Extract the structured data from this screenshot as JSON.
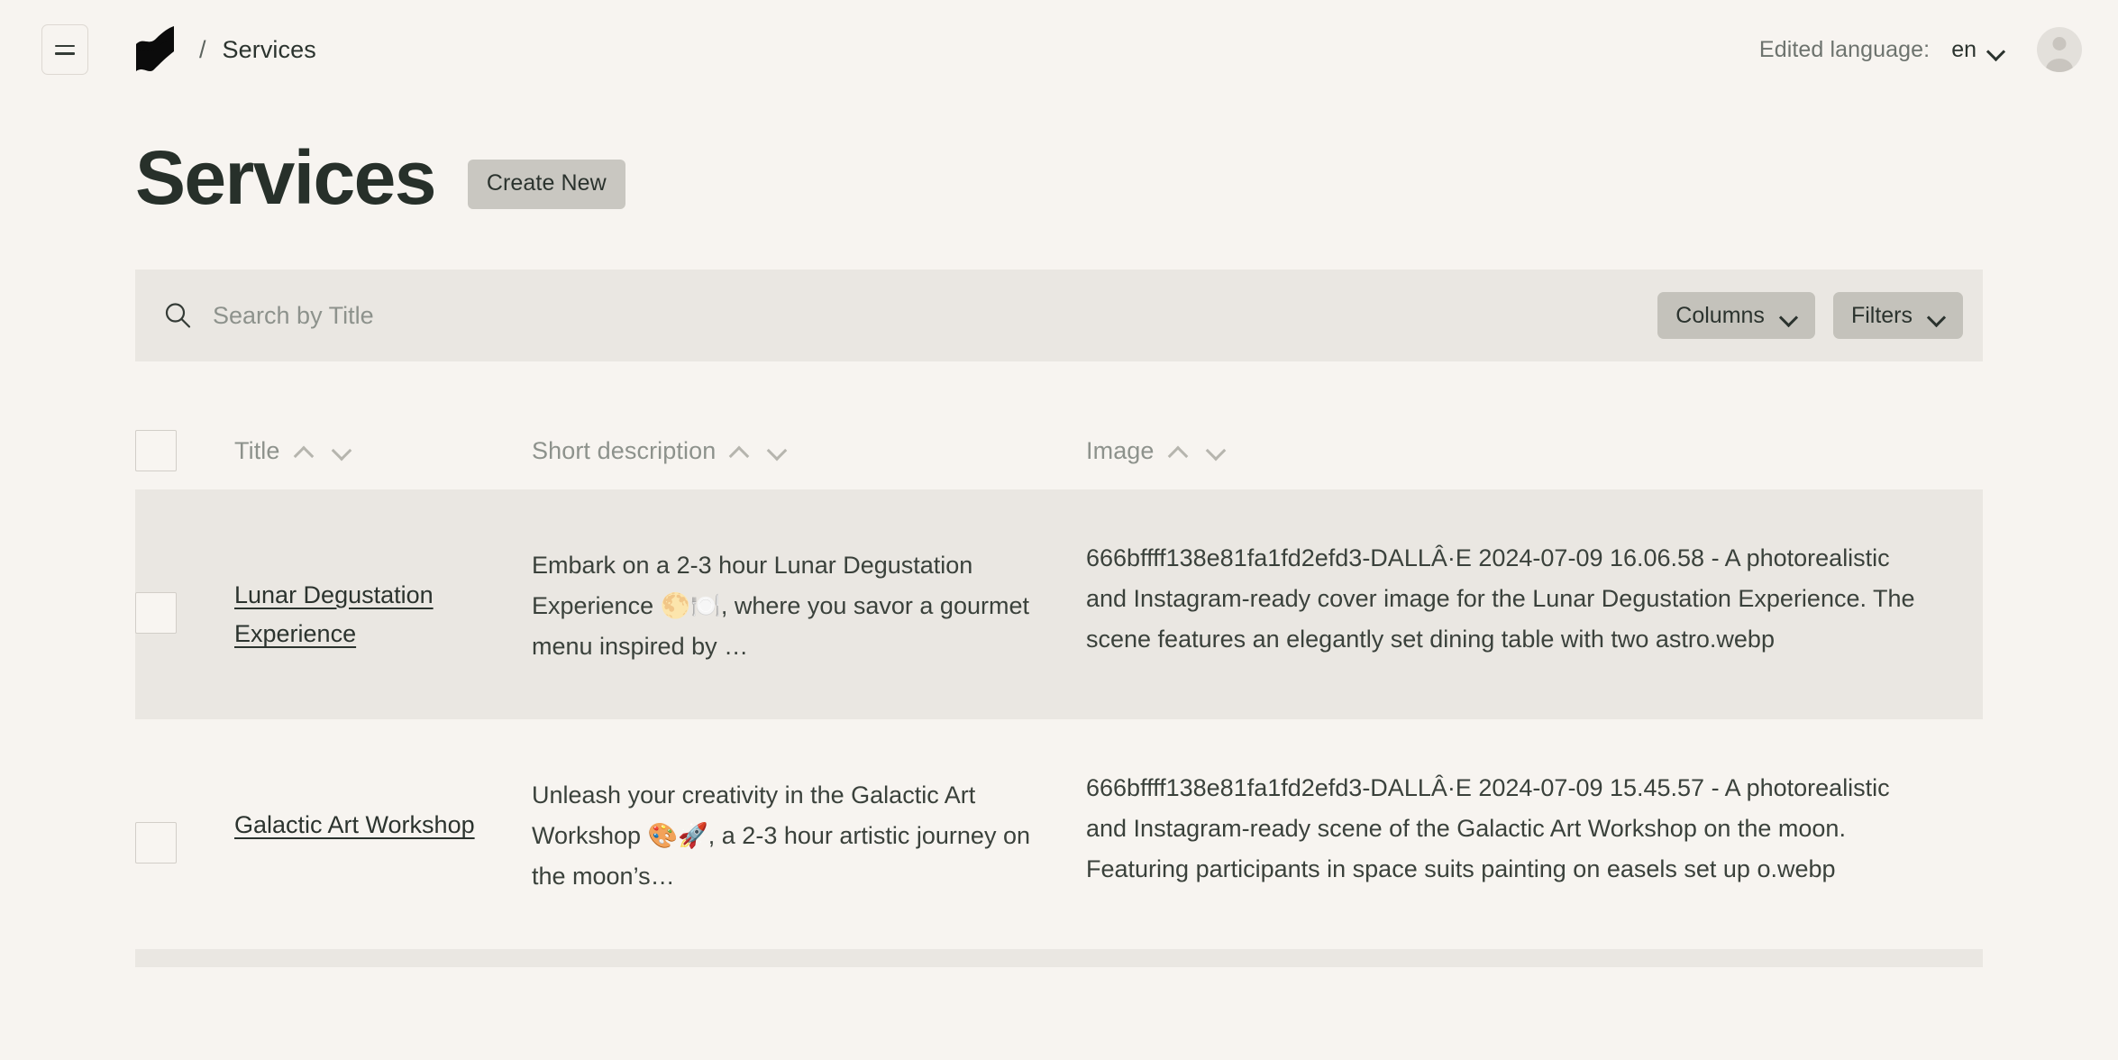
{
  "topbar": {
    "menu_icon": "hamburger-icon",
    "logo_icon": "payload-logo-icon",
    "breadcrumb_separator": "/",
    "breadcrumb_current": "Services",
    "edited_language_label": "Edited language:",
    "edited_language_value": "en",
    "language_chevron_icon": "chevron-down-icon",
    "avatar_icon": "user-avatar-icon"
  },
  "page": {
    "title": "Services",
    "create_new_label": "Create New"
  },
  "search": {
    "icon": "search-icon",
    "placeholder": "Search by Title",
    "value": "",
    "columns_label": "Columns",
    "filters_label": "Filters",
    "columns_chevron_icon": "chevron-down-icon",
    "filters_chevron_icon": "chevron-down-icon"
  },
  "table": {
    "select_all_checkbox": "",
    "columns": [
      {
        "label": "Title",
        "sort_up_icon": "caret-up-icon",
        "sort_down_icon": "caret-down-icon"
      },
      {
        "label": "Short description",
        "sort_up_icon": "caret-up-icon",
        "sort_down_icon": "caret-down-icon"
      },
      {
        "label": "Image",
        "sort_up_icon": "caret-up-icon",
        "sort_down_icon": "caret-down-icon"
      }
    ],
    "rows": [
      {
        "title": "Lunar Degustation Experience",
        "short_description": "Embark on a 2-3 hour Lunar Degustation Experience 🌕🍽️, where you savor a gourmet menu inspired by …",
        "image": "666bffff138e81fa1fd2efd3-DALLÂ·E 2024-07-09 16.06.58 - A photorealistic and Instagram-ready cover image for the Lunar Degustation Experience. The scene features an elegantly set dining table with two astro.webp"
      },
      {
        "title": "Galactic Art Workshop",
        "short_description": "Unleash your creativity in the Galactic Art Workshop 🎨🚀, a 2-3 hour artistic journey on the moon’s…",
        "image": "666bffff138e81fa1fd2efd3-DALLÂ·E 2024-07-09 15.45.57 - A photorealistic and Instagram-ready scene of the Galactic Art Workshop on the moon. Featuring participants in space suits painting on easels set up o.webp"
      }
    ]
  },
  "colors": {
    "page_background": "#f7f4f0",
    "stripe_background": "#eae7e2",
    "button_background": "#c9c7c1",
    "pill_background": "#c4c2bb",
    "text_primary": "#2b332e",
    "text_muted": "#8d928c"
  }
}
